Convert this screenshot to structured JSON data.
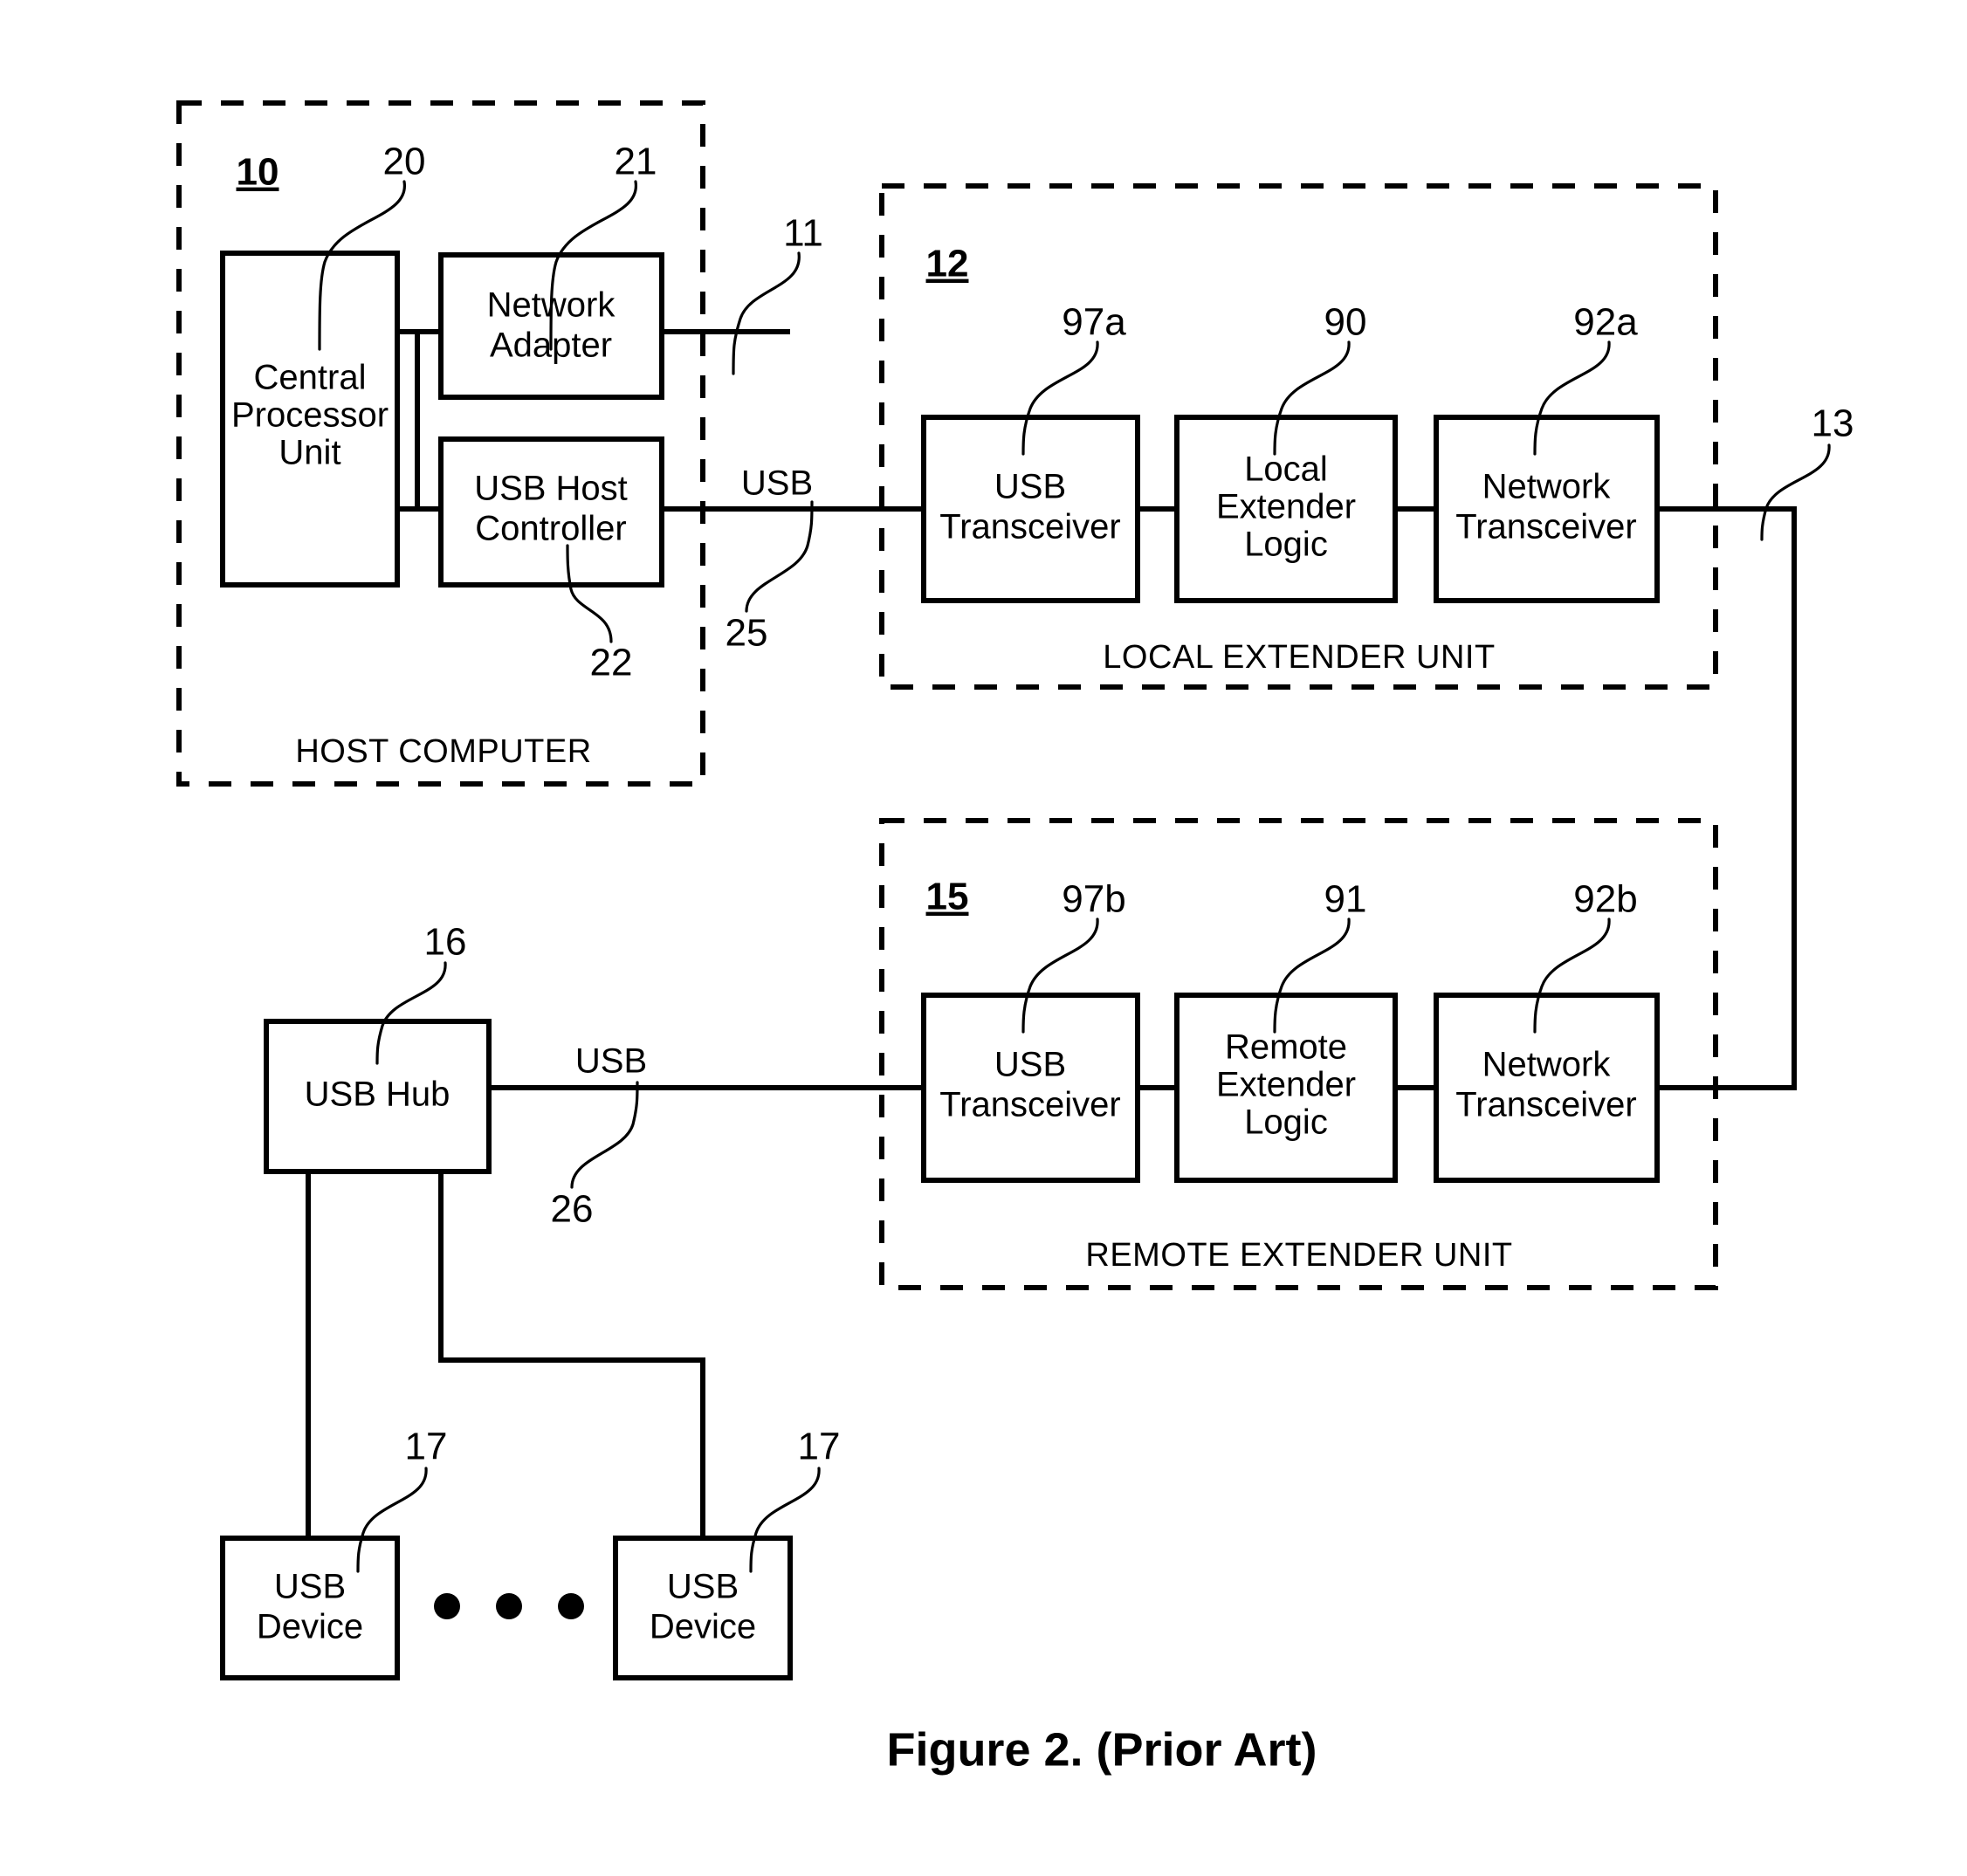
{
  "figure": {
    "caption": "Figure 2. (Prior Art)"
  },
  "groups": {
    "host_computer": {
      "ref": "10",
      "caption": "HOST COMPUTER"
    },
    "local_extender": {
      "ref": "12",
      "caption": "LOCAL EXTENDER UNIT"
    },
    "remote_extender": {
      "ref": "15",
      "caption": "REMOTE EXTENDER UNIT"
    }
  },
  "blocks": {
    "cpu": {
      "line1": "Central",
      "line2": "Processor",
      "line3": "Unit",
      "ref": "20"
    },
    "network_adapter": {
      "line1": "Network",
      "line2": "Adapter",
      "ref": "21"
    },
    "usb_host_controller": {
      "line1": "USB Host",
      "line2": "Controller",
      "ref": "22"
    },
    "local_usb_transceiver": {
      "line1": "USB",
      "line2": "Transceiver",
      "ref": "97a"
    },
    "local_extender_logic": {
      "line1": "Local",
      "line2": "Extender",
      "line3": "Logic",
      "ref": "90"
    },
    "local_network_transceiver": {
      "line1": "Network",
      "line2": "Transceiver",
      "ref": "92a"
    },
    "remote_usb_transceiver": {
      "line1": "USB",
      "line2": "Transceiver",
      "ref": "97b"
    },
    "remote_extender_logic": {
      "line1": "Remote",
      "line2": "Extender",
      "line3": "Logic",
      "ref": "91"
    },
    "remote_network_transceiver": {
      "line1": "Network",
      "line2": "Transceiver",
      "ref": "92b"
    },
    "usb_hub": {
      "line1": "USB Hub",
      "ref": "16"
    },
    "usb_device_left": {
      "line1": "USB",
      "line2": "Device",
      "ref": "17"
    },
    "usb_device_right": {
      "line1": "USB",
      "line2": "Device",
      "ref": "17"
    }
  },
  "connections": {
    "network_link_ref": "11",
    "host_usb_label": "USB",
    "host_usb_ref": "25",
    "remote_usb_label": "USB",
    "remote_usb_ref": "26",
    "network_backbone_ref": "13"
  },
  "colors": {
    "stroke": "#000000",
    "background": "#ffffff"
  },
  "ellipsis_dots": 3
}
